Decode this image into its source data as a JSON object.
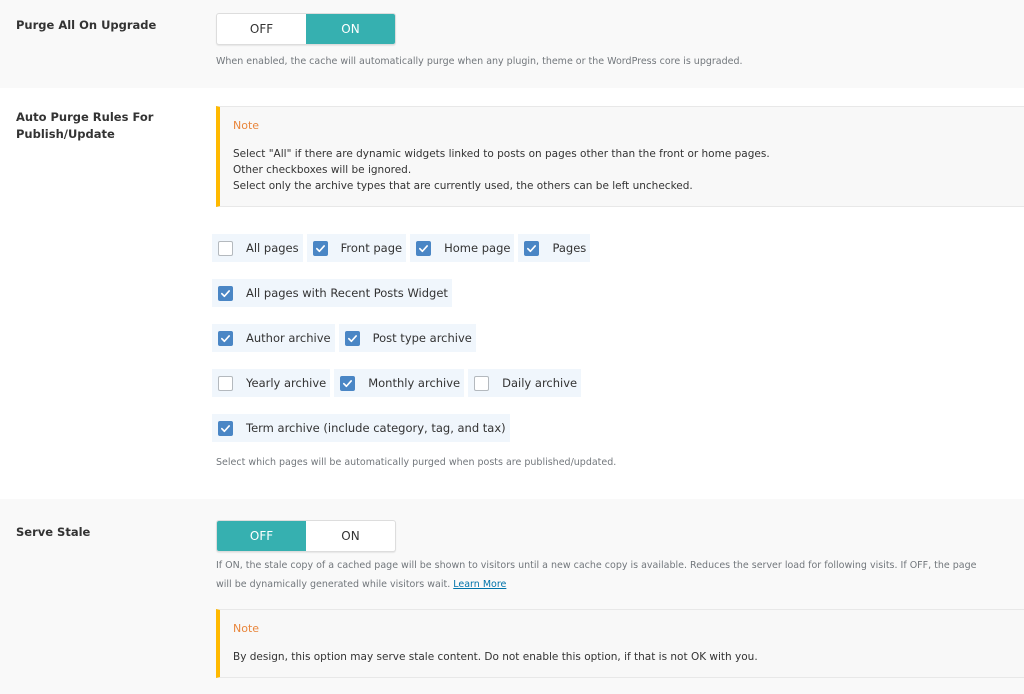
{
  "colors": {
    "accent": "#36b0b0",
    "checkbox": "#4a86c5",
    "note_border": "#ffb900",
    "note_title": "#e9863c",
    "link": "#0073aa"
  },
  "purge_all_on_upgrade": {
    "label": "Purge All On Upgrade",
    "toggle": {
      "off_label": "OFF",
      "on_label": "ON",
      "value": "ON"
    },
    "description": "When enabled, the cache will automatically purge when any plugin, theme or the WordPress core is upgraded."
  },
  "auto_purge_rules": {
    "label_line1": "Auto Purge Rules For",
    "label_line2": "Publish/Update",
    "note": {
      "title": "Note",
      "lines": [
        "Select \"All\" if there are dynamic widgets linked to posts on pages other than the front or home pages.",
        "Other checkboxes will be ignored.",
        "Select only the archive types that are currently used, the others can be left unchecked."
      ]
    },
    "checkbox_rows": [
      [
        {
          "label": "All pages",
          "checked": false
        },
        {
          "label": "Front page",
          "checked": true
        },
        {
          "label": "Home page",
          "checked": true
        },
        {
          "label": "Pages",
          "checked": true
        }
      ],
      [
        {
          "label": "All pages with Recent Posts Widget",
          "checked": true
        }
      ],
      [
        {
          "label": "Author archive",
          "checked": true
        },
        {
          "label": "Post type archive",
          "checked": true
        }
      ],
      [
        {
          "label": "Yearly archive",
          "checked": false
        },
        {
          "label": "Monthly archive",
          "checked": true
        },
        {
          "label": "Daily archive",
          "checked": false
        }
      ],
      [
        {
          "label": "Term archive (include category, tag, and tax)",
          "checked": true
        }
      ]
    ],
    "description": "Select which pages will be automatically purged when posts are published/updated."
  },
  "serve_stale": {
    "label": "Serve Stale",
    "toggle": {
      "off_label": "OFF",
      "on_label": "ON",
      "value": "OFF"
    },
    "description_line1": "If ON, the stale copy of a cached page will be shown to visitors until a new cache copy is available. Reduces the server load for following visits. If OFF, the page",
    "description_line2": "will be dynamically generated while visitors wait.",
    "learn_more": "Learn More",
    "note": {
      "title": "Note",
      "lines": [
        "By design, this option may serve stale content. Do not enable this option, if that is not OK with you."
      ]
    }
  }
}
